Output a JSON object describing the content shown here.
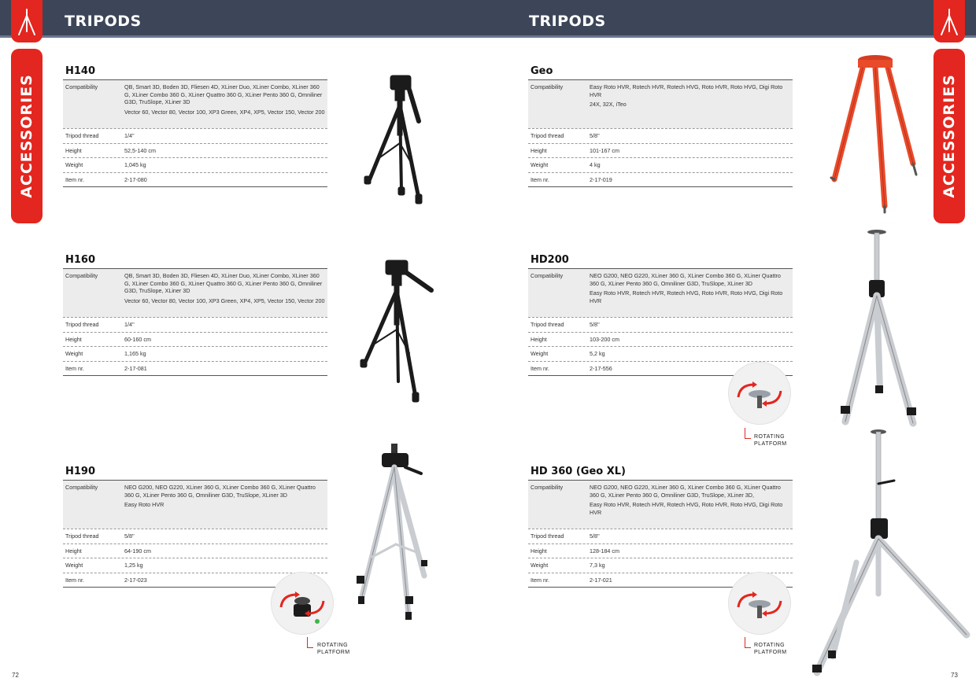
{
  "pages": {
    "left": {
      "section_title": "TRIPODS",
      "tab_label": "ACCESSORIES",
      "page_number": "72"
    },
    "right": {
      "section_title": "TRIPODS",
      "tab_label": "ACCESSORIES",
      "page_number": "73"
    }
  },
  "labels": {
    "compatibility": "Compatibility",
    "tripod_thread": "Tripod thread",
    "height": "Height",
    "weight": "Weight",
    "item_nr": "Item nr."
  },
  "rotating_platform": {
    "line1": "ROTATING",
    "line2": "PLATFORM"
  },
  "products": {
    "h140": {
      "name": "H140",
      "compat_1": "QB, Smart 3D, Boden 3D, Fliesen 4D, XLiner Duo, XLiner Combo, XLiner 360 G, XLiner Combo 360 G, XLiner Quattro 360 G, XLiner Pento 360 G, Omniliner G3D, TruSlope, XLiner 3D",
      "compat_2": "Vector 60, Vector 80, Vector 100, XP3 Green, XP4, XP5, Vector 150, Vector 200",
      "thread": "1/4\"",
      "height": "52,5-140 cm",
      "weight": "1,045 kg",
      "item": "2-17-080"
    },
    "h160": {
      "name": "H160",
      "compat_1": "QB, Smart 3D, Boden 3D, Fliesen 4D, XLiner Duo, XLiner Combo, XLiner 360 G, XLiner Combo 360 G, XLiner Quattro 360 G, XLiner Pento 360 G, Omniliner G3D, TruSlope, XLiner 3D",
      "compat_2": "Vector 60, Vector 80, Vector 100, XP3 Green, XP4, XP5, Vector 150, Vector 200",
      "thread": "1/4''",
      "height": "60-160 cm",
      "weight": "1,165 kg",
      "item": "2-17-081"
    },
    "h190": {
      "name": "H190",
      "compat_1": "NEO G200, NEO G220, XLiner 360 G, XLiner Combo 360 G, XLiner Quattro 360 G, XLiner Pento 360 G, Omniliner G3D, TruSlope, XLiner 3D",
      "compat_2": "Easy Roto HVR",
      "thread": "5/8''",
      "height": "64-190 cm",
      "weight": "1,25 kg",
      "item": "2-17-023"
    },
    "geo": {
      "name": "Geo",
      "compat_1": "Easy Roto HVR, Rotech HVR, Rotech HVG, Roto HVR, Roto HVG, Digi Roto HVR",
      "compat_2": "24X, 32X, iTeo",
      "thread": "5/8''",
      "height": "101-167 cm",
      "weight": "4 kg",
      "item": "2-17-019"
    },
    "hd200": {
      "name": "HD200",
      "compat_1": "NEO G200, NEO G220, XLiner 360 G, XLiner Combo 360 G, XLiner Quattro 360 G, XLiner Pento 360 G, Omniliner G3D, TruSlope, XLiner 3D",
      "compat_2": "Easy Roto HVR, Rotech HVR, Rotech HVG, Roto HVR, Roto HVG, Digi Roto HVR",
      "thread": "5/8''",
      "height": "103-200 cm",
      "weight": "5,2 kg",
      "item": "2-17-556"
    },
    "hd360": {
      "name": "HD 360 (Geo XL)",
      "compat_1": "NEO G200, NEO G220, XLiner 360 G, XLiner Combo 360 G, XLiner Quattro 360 G, XLiner Pento 360 G, Omniliner G3D, TruSlope, XLiner 3D,",
      "compat_2": "Easy Roto HVR, Rotech HVR, Rotech HVG, Roto HVR, Roto HVG, Digi Roto HVR",
      "thread": "5/8''",
      "height": "128-184 cm",
      "weight": "7,3 kg",
      "item": "2-17-021"
    }
  },
  "colors": {
    "header": "#3c4658",
    "accent_red": "#e3261f",
    "compat_bg": "#ececec",
    "tripod_black": "#1b1b1b",
    "tripod_silver": "#c9ccd0",
    "tripod_orange": "#e84a2a"
  }
}
